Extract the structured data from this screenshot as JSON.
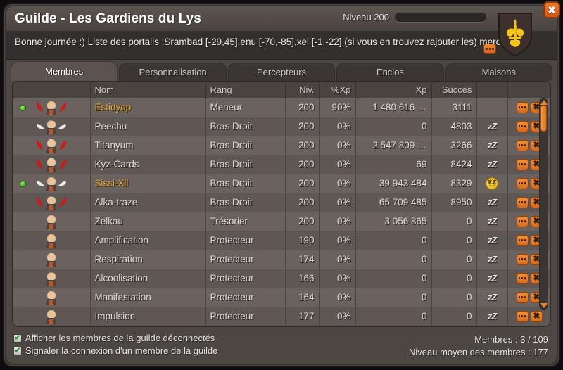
{
  "window": {
    "close_label": "✖"
  },
  "header": {
    "title": "Guilde - Les Gardiens du Lys",
    "level_label": "Niveau 200",
    "level_percent": 0,
    "emblem_icon": "fleur-de-lys-shield",
    "accent_color": "#e8862a",
    "online_color": "#4ec31a"
  },
  "banner": {
    "text": "Bonne journée :) Liste des portails :Srambad [-29,45],enu [-70,-85],xel [-1,-22] (si vous en trouvez rajouter les) merci!",
    "edit_icon": "ellipsis-icon"
  },
  "tabs": [
    {
      "label": "Membres",
      "active": true
    },
    {
      "label": "Personnalisation",
      "active": false
    },
    {
      "label": "Percepteurs",
      "active": false
    },
    {
      "label": "Enclos",
      "active": false
    },
    {
      "label": "Maisons",
      "active": false
    }
  ],
  "table": {
    "columns": [
      "",
      "Nom",
      "Rang",
      "Niv.",
      "%Xp",
      "Xp",
      "Succès",
      "",
      ""
    ],
    "rows": [
      {
        "online": true,
        "wings": "demon",
        "name": "Estidyop",
        "highlight": true,
        "rank": "Meneur",
        "level": "200",
        "xp_pct": "90%",
        "xp": "1 480 616 …",
        "succes": "3111",
        "mood": "none"
      },
      {
        "online": false,
        "wings": "angel",
        "name": "Peechu",
        "highlight": false,
        "rank": "Bras Droit",
        "level": "200",
        "xp_pct": "0%",
        "xp": "0",
        "succes": "4803",
        "mood": "sleep"
      },
      {
        "online": false,
        "wings": "demon",
        "name": "Titanyum",
        "highlight": false,
        "rank": "Bras Droit",
        "level": "200",
        "xp_pct": "0%",
        "xp": "2 547 809 …",
        "succes": "3266",
        "mood": "sleep"
      },
      {
        "online": false,
        "wings": "demon",
        "name": "Kyz-Cards",
        "highlight": false,
        "rank": "Bras Droit",
        "level": "200",
        "xp_pct": "0%",
        "xp": "69",
        "succes": "8424",
        "mood": "sleep"
      },
      {
        "online": true,
        "wings": "angel",
        "name": "Sissi-Xll",
        "highlight": true,
        "rank": "Bras Droit",
        "level": "200",
        "xp_pct": "0%",
        "xp": "39 943 484",
        "succes": "8329",
        "mood": "smiley"
      },
      {
        "online": false,
        "wings": "demon",
        "name": "Alka-traze",
        "highlight": false,
        "rank": "Bras Droit",
        "level": "200",
        "xp_pct": "0%",
        "xp": "65 709 485",
        "succes": "8950",
        "mood": "sleep"
      },
      {
        "online": false,
        "wings": "none",
        "name": "Zelkau",
        "highlight": false,
        "rank": "Trésorier",
        "level": "200",
        "xp_pct": "0%",
        "xp": "3 056 865",
        "succes": "0",
        "mood": "sleep"
      },
      {
        "online": false,
        "wings": "none",
        "name": "Amplification",
        "highlight": false,
        "rank": "Protecteur",
        "level": "190",
        "xp_pct": "0%",
        "xp": "0",
        "succes": "0",
        "mood": "sleep"
      },
      {
        "online": false,
        "wings": "none",
        "name": "Respiration",
        "highlight": false,
        "rank": "Protecteur",
        "level": "174",
        "xp_pct": "0%",
        "xp": "0",
        "succes": "0",
        "mood": "sleep"
      },
      {
        "online": false,
        "wings": "none",
        "name": "Alcoolisation",
        "highlight": false,
        "rank": "Protecteur",
        "level": "166",
        "xp_pct": "0%",
        "xp": "0",
        "succes": "0",
        "mood": "sleep"
      },
      {
        "online": false,
        "wings": "none",
        "name": "Manifestation",
        "highlight": false,
        "rank": "Protecteur",
        "level": "164",
        "xp_pct": "0%",
        "xp": "0",
        "succes": "0",
        "mood": "sleep"
      },
      {
        "online": false,
        "wings": "none",
        "name": "Impulsion",
        "highlight": false,
        "rank": "Protecteur",
        "level": "177",
        "xp_pct": "0%",
        "xp": "0",
        "succes": "0",
        "mood": "sleep"
      }
    ],
    "row_actions": {
      "menu_icon": "ellipsis-icon",
      "remove_icon": "close-x-icon"
    },
    "mood_sleep_text": "zZ"
  },
  "scrollbar": {
    "up_icon": "caret-up-icon",
    "down_icon": "caret-down-icon",
    "thumb_position_pct": 0
  },
  "footer": {
    "checkboxes": [
      {
        "label": "Afficher les membres de la guilde déconnectés",
        "checked": true
      },
      {
        "label": "Signaler la connexion d'un membre de la guilde",
        "checked": true
      }
    ],
    "check_mark": "✔",
    "stats": [
      "Membres : 3 / 109",
      "Niveau moyen des membres : 177"
    ]
  }
}
